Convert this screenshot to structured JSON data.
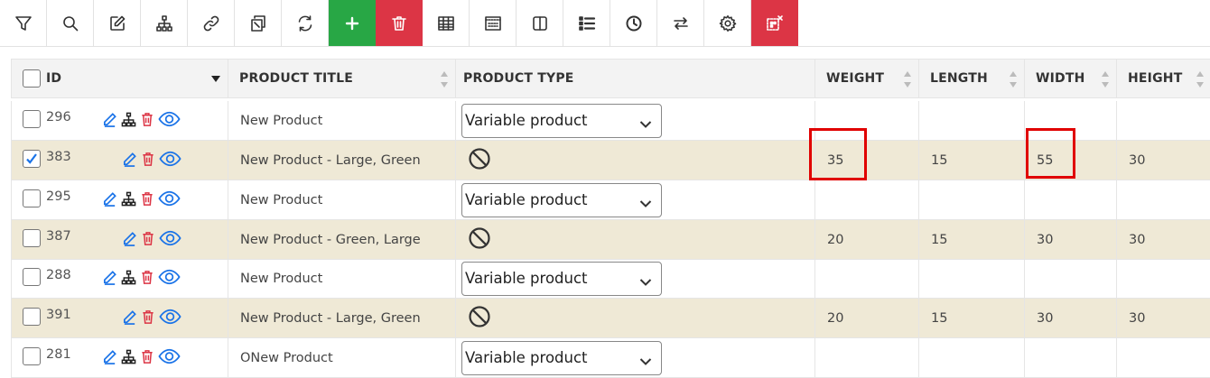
{
  "toolbar": {
    "buttons": [
      {
        "name": "filter-icon"
      },
      {
        "name": "search-icon"
      },
      {
        "name": "edit-icon"
      },
      {
        "name": "hierarchy-icon"
      },
      {
        "name": "link-icon"
      },
      {
        "name": "duplicate-icon"
      },
      {
        "name": "refresh-icon"
      },
      {
        "name": "add-icon"
      },
      {
        "name": "delete-icon"
      },
      {
        "name": "table-icon"
      },
      {
        "name": "grid-view-icon"
      },
      {
        "name": "columns-icon"
      },
      {
        "name": "list-icon"
      },
      {
        "name": "history-icon"
      },
      {
        "name": "swap-icon"
      },
      {
        "name": "settings-icon"
      },
      {
        "name": "clear-selection-icon"
      }
    ],
    "colors": {
      "add": "#28a745",
      "delete": "#dc3545",
      "clear": "#dc3545"
    }
  },
  "table": {
    "headers": {
      "id": "ID",
      "title": "PRODUCT TITLE",
      "type": "PRODUCT TYPE",
      "weight": "WEIGHT",
      "length": "LENGTH",
      "width": "WIDTH",
      "height": "HEIGHT"
    },
    "rows": [
      {
        "id": "296",
        "title": "New Product",
        "type": "Variable product",
        "weight": "",
        "length": "",
        "width": "",
        "height": "",
        "checked": false,
        "variation": false
      },
      {
        "id": "383",
        "title": "New Product - Large, Green",
        "type": "",
        "weight": "35",
        "length": "15",
        "width": "55",
        "height": "30",
        "checked": true,
        "variation": true
      },
      {
        "id": "295",
        "title": "New Product",
        "type": "Variable product",
        "weight": "",
        "length": "",
        "width": "",
        "height": "",
        "checked": false,
        "variation": false
      },
      {
        "id": "387",
        "title": "New Product - Green, Large",
        "type": "",
        "weight": "20",
        "length": "15",
        "width": "30",
        "height": "30",
        "checked": false,
        "variation": true
      },
      {
        "id": "288",
        "title": "New Product",
        "type": "Variable product",
        "weight": "",
        "length": "",
        "width": "",
        "height": "",
        "checked": false,
        "variation": false
      },
      {
        "id": "391",
        "title": "New Product - Large, Green",
        "type": "",
        "weight": "20",
        "length": "15",
        "width": "30",
        "height": "30",
        "checked": false,
        "variation": true
      },
      {
        "id": "281",
        "title": "ONew Product",
        "type": "Variable product",
        "weight": "",
        "length": "",
        "width": "",
        "height": "",
        "checked": false,
        "variation": false
      }
    ]
  },
  "highlight_color": "#e00000"
}
